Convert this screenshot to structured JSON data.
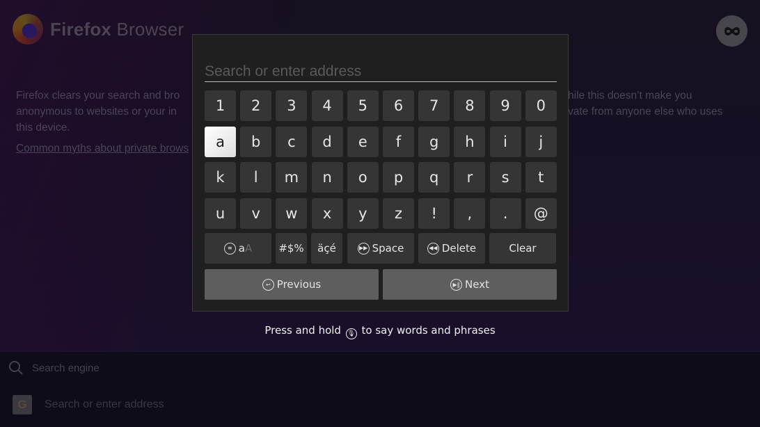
{
  "app": {
    "logo_bold": "Firefox",
    "logo_light": " Browser"
  },
  "private_mode": {
    "icon": "mask-icon"
  },
  "info": {
    "lines_left": [
      "Firefox clears your search and bro",
      "anonymous to websites or your in",
      "this device."
    ],
    "lines_right": [
      "hile this doesn’t make you",
      "vate from anyone else who uses"
    ],
    "link": "Common myths about private brows"
  },
  "keyboard": {
    "input_placeholder": "Search or enter address",
    "input_value": "",
    "rows": [
      [
        "1",
        "2",
        "3",
        "4",
        "5",
        "6",
        "7",
        "8",
        "9",
        "0"
      ],
      [
        "a",
        "b",
        "c",
        "d",
        "e",
        "f",
        "g",
        "h",
        "i",
        "j"
      ],
      [
        "k",
        "l",
        "m",
        "n",
        "o",
        "p",
        "q",
        "r",
        "s",
        "t"
      ],
      [
        "u",
        "v",
        "w",
        "x",
        "y",
        "z",
        "!",
        ",",
        ".",
        "@"
      ]
    ],
    "selected_key": "a",
    "function_keys": {
      "case_toggle": "a",
      "case_toggle_dim": "A",
      "symbols": "#$%",
      "accents": "äçé",
      "space": "Space",
      "delete": "Delete",
      "clear": "Clear"
    },
    "previous": "Previous",
    "next": "Next"
  },
  "hint": {
    "before": "Press and hold ",
    "after": " to say words and phrases"
  },
  "bottom_bar": {
    "search_engine_label": "Search engine",
    "address_placeholder": "Search or enter address",
    "engine_icon": "G"
  }
}
